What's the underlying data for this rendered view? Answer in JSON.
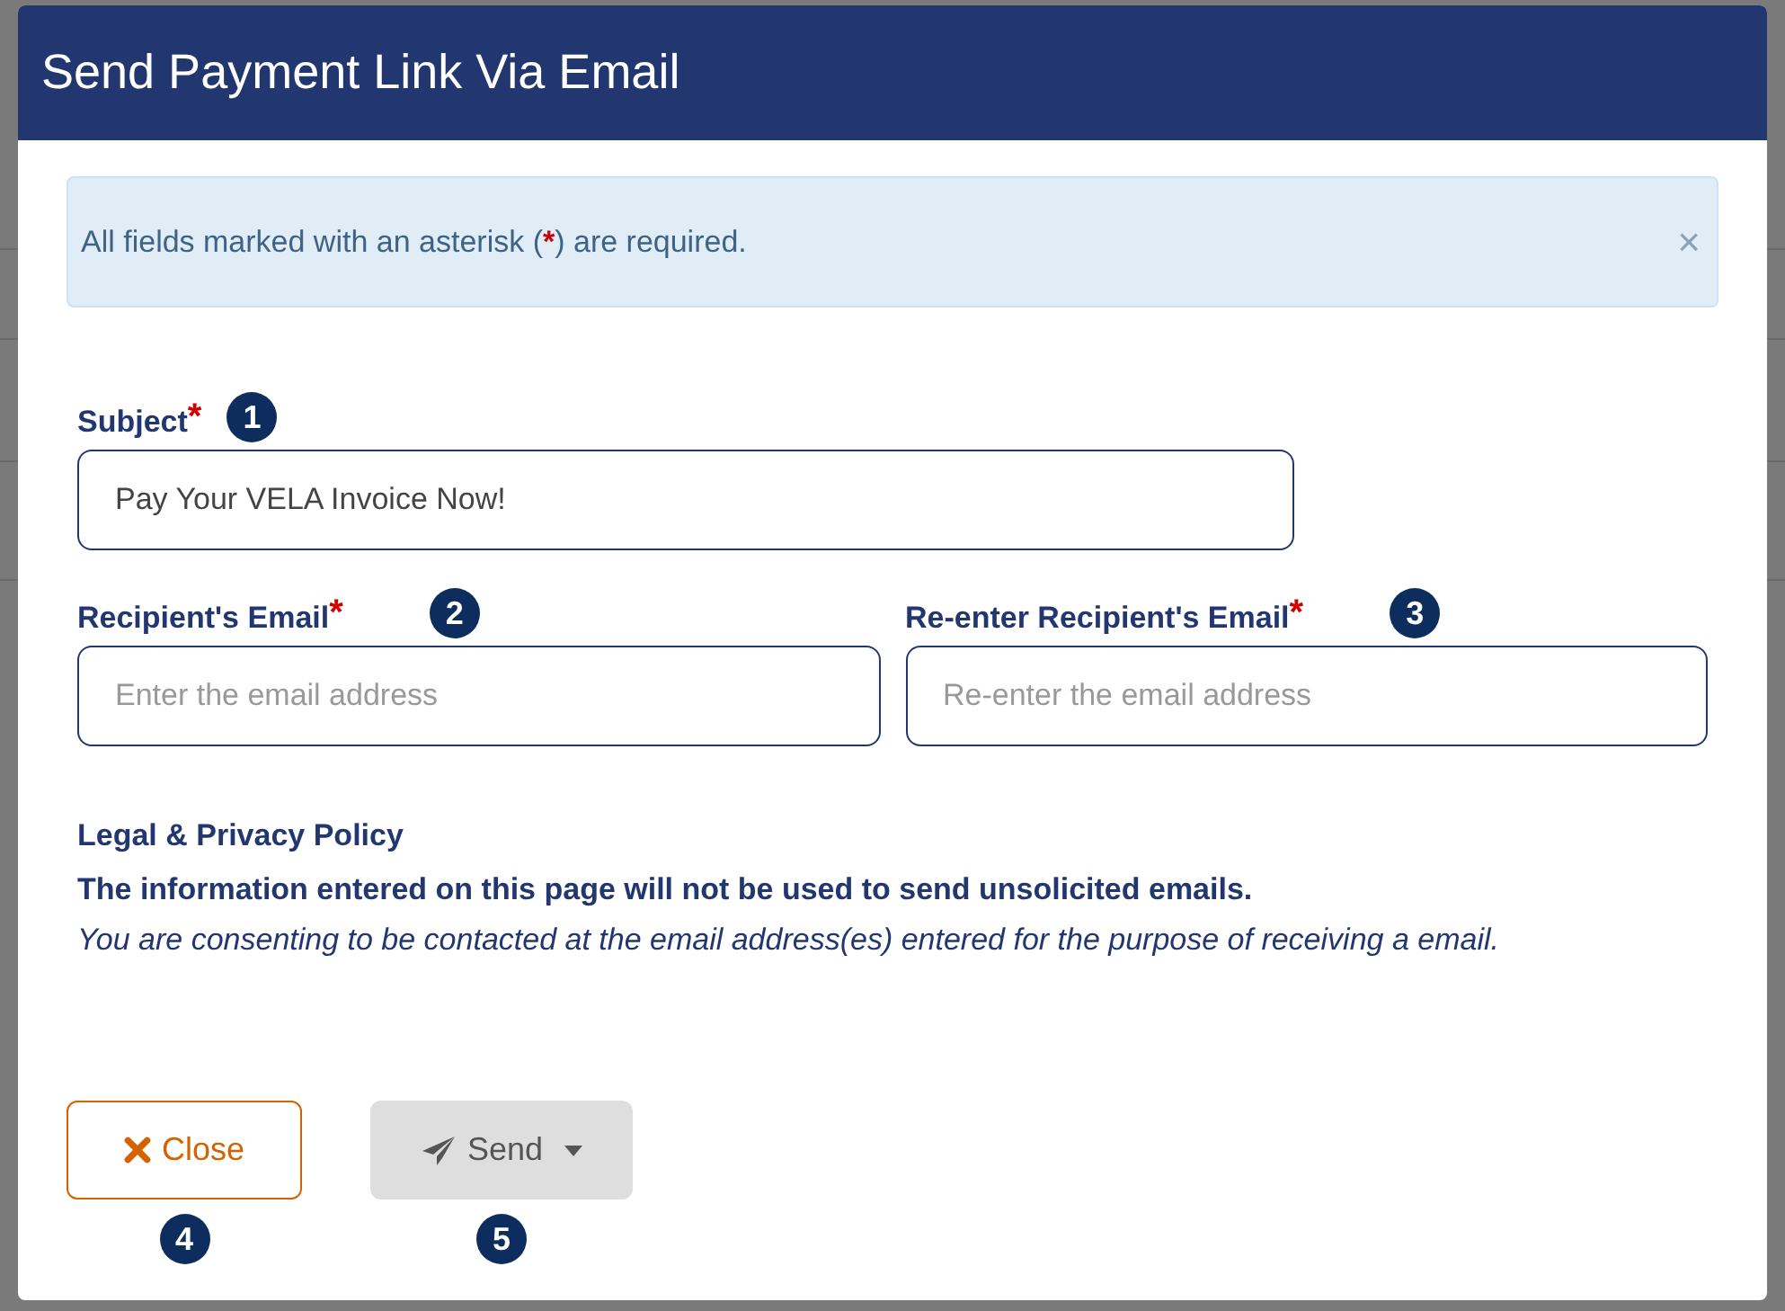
{
  "dialog": {
    "title": "Send Payment Link Via Email"
  },
  "alert": {
    "before": "All fields marked with an asterisk (",
    "mark": "*",
    "after": ") are required.",
    "close": "×"
  },
  "field_rows": [
    {
      "fields": [
        {
          "label": "Subject",
          "required_mark": "*",
          "badge": "1",
          "value": "Pay Your VELA Invoice Now!"
        }
      ]
    },
    {
      "fields": [
        {
          "label": "Recipient's Email",
          "required_mark": "*",
          "badge": "2",
          "placeholder": "Enter the email address"
        },
        {
          "label": "Re-enter Recipient's Email",
          "required_mark": "*",
          "badge": "3",
          "placeholder": "Re-enter the email address"
        }
      ]
    }
  ],
  "legal": {
    "heading": "Legal & Privacy Policy",
    "notice": "The information entered on this page will not be used to send unsolicited emails.",
    "consent": "You are consenting to be contacted at the email address(es) entered for the purpose of receiving a email."
  },
  "buttons": [
    {
      "kind": "close",
      "label": "Close",
      "badge": "4",
      "disabled": false
    },
    {
      "kind": "send",
      "label": "Send",
      "badge": "5",
      "disabled": true
    }
  ]
}
